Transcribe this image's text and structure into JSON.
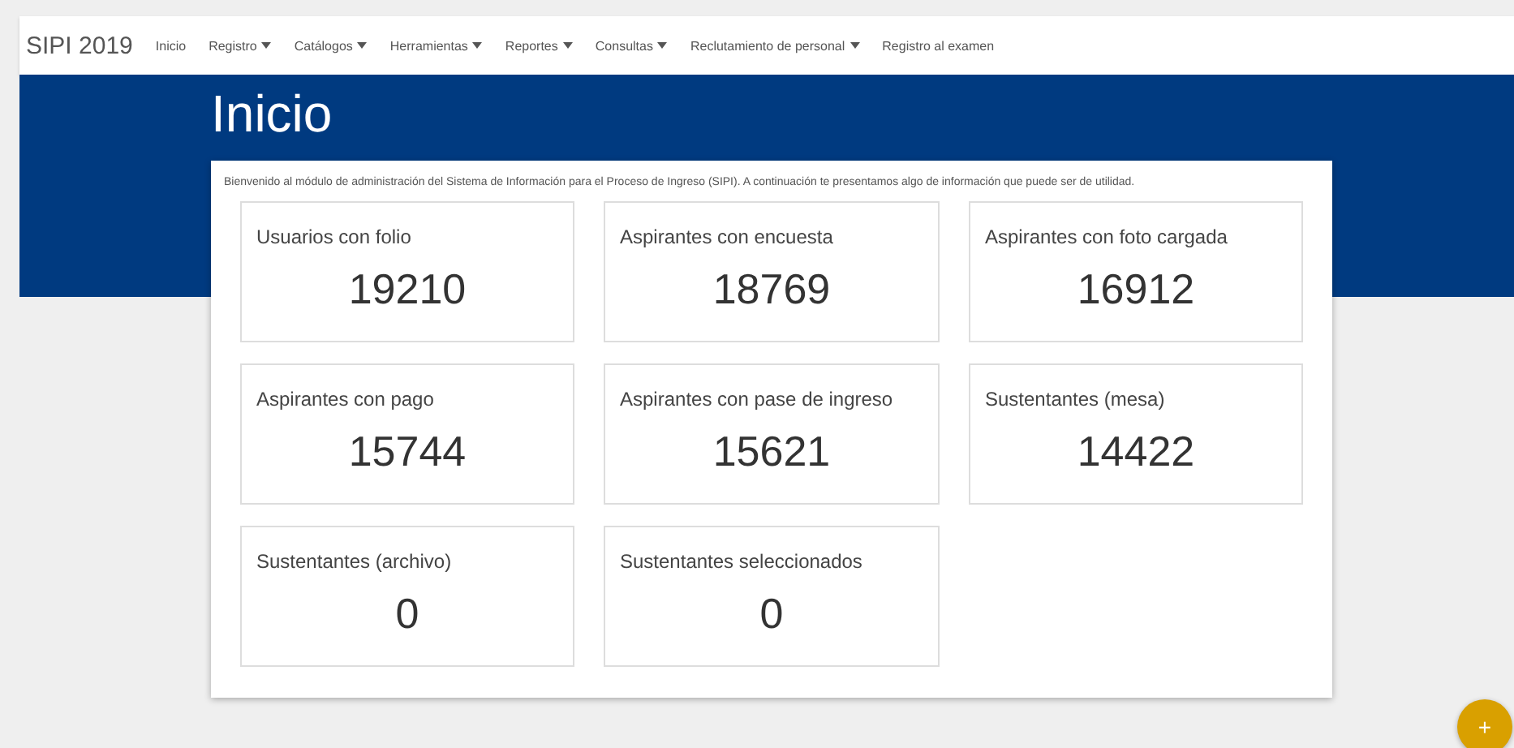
{
  "navbar": {
    "brand": "SIPI 2019",
    "items": [
      {
        "label": "Inicio",
        "has_menu": false
      },
      {
        "label": "Registro",
        "has_menu": true
      },
      {
        "label": "Catálogos",
        "has_menu": true
      },
      {
        "label": "Herramientas",
        "has_menu": true
      },
      {
        "label": "Reportes",
        "has_menu": true
      },
      {
        "label": "Consultas",
        "has_menu": true
      },
      {
        "label": "Reclutamiento de personal",
        "has_menu": true
      },
      {
        "label": "Registro al examen",
        "has_menu": false
      }
    ]
  },
  "page_title": "Inicio",
  "intro": "Bienvenido al módulo de administración del Sistema de Información para el Proceso de Ingreso (SIPI). A continuación te presentamos algo de información que puede ser de utilidad.",
  "stats": [
    {
      "label": "Usuarios con folio",
      "value": "19210"
    },
    {
      "label": "Aspirantes con encuesta",
      "value": "18769"
    },
    {
      "label": "Aspirantes con foto cargada",
      "value": "16912"
    },
    {
      "label": "Aspirantes con pago",
      "value": "15744"
    },
    {
      "label": "Aspirantes con pase de ingreso",
      "value": "15621"
    },
    {
      "label": "Sustentantes (mesa)",
      "value": "14422"
    },
    {
      "label": "Sustentantes (archivo)",
      "value": "0"
    },
    {
      "label": "Sustentantes seleccionados",
      "value": "0"
    }
  ],
  "fab": {
    "label": "+"
  }
}
